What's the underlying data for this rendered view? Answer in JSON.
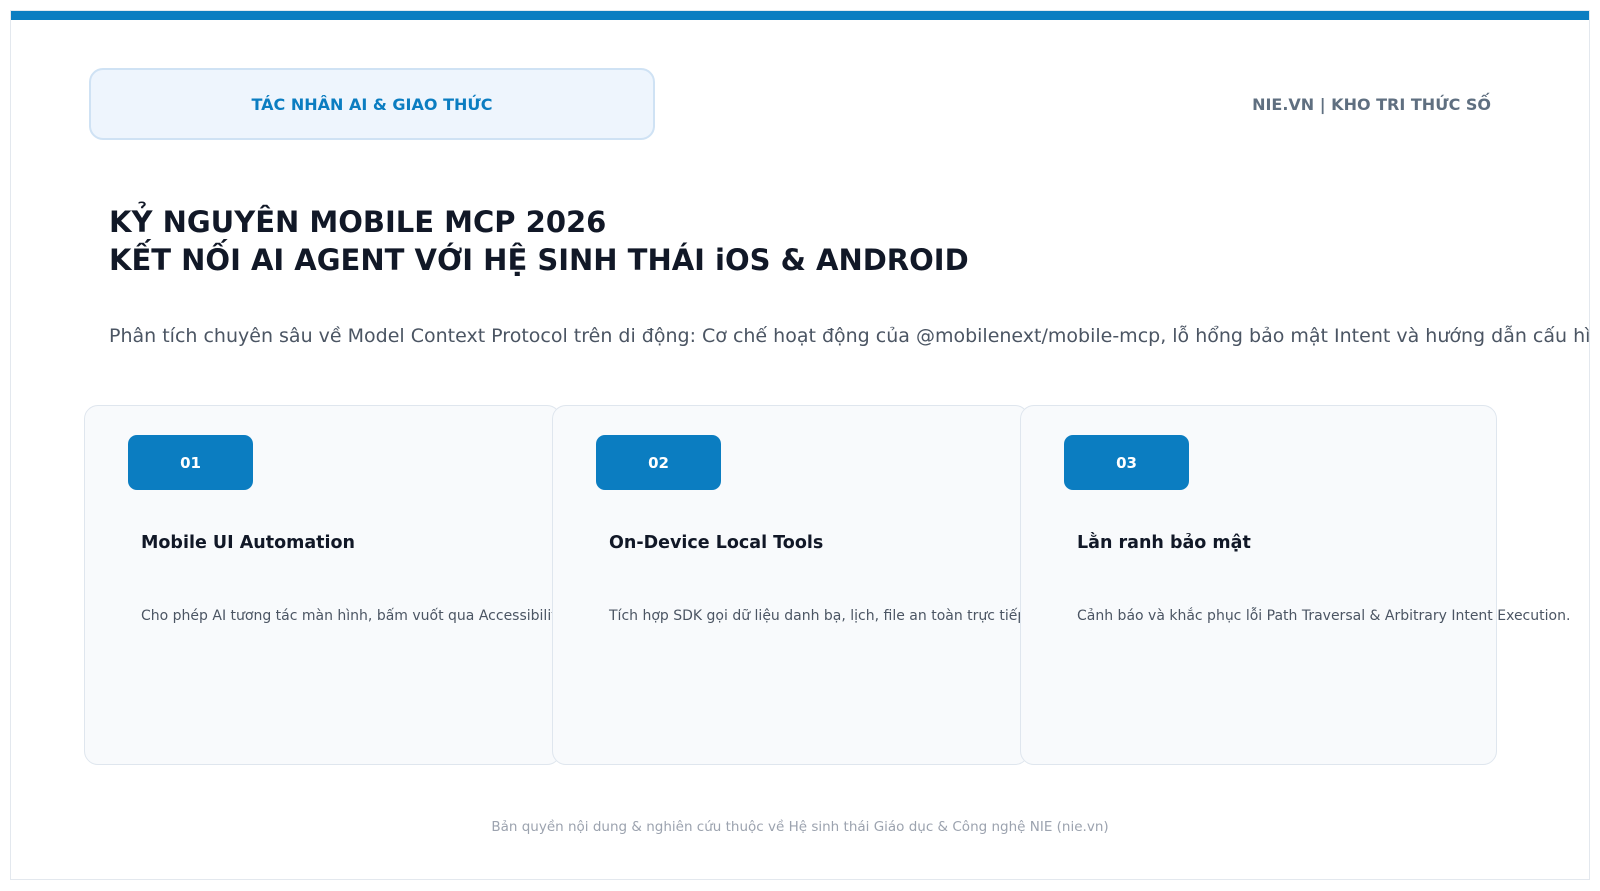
{
  "header": {
    "category": "TÁC NHÂN AI & GIAO THỨC",
    "brand": "NIE.VN | KHO TRI THỨC SỐ"
  },
  "main": {
    "title_line1": "KỶ NGUYÊN MOBILE MCP 2026",
    "title_line2": "KẾT NỐI AI AGENT VỚI HỆ SINH THÁI iOS & ANDROID",
    "subtitle": "Phân tích chuyên sâu về Model Context Protocol trên di động: Cơ chế hoạt động của @mobilenext/mobile-mcp, lỗ hổng bảo mật Intent và hướng dẫn cấu hình chi tiết."
  },
  "cards": [
    {
      "number": "01",
      "title": "Mobile UI Automation",
      "description": "Cho phép AI tương tác màn hình, bấm vuốt qua Accessibility tree hoặc tọa độ."
    },
    {
      "number": "02",
      "title": "On-Device Local Tools",
      "description": "Tích hợp SDK gọi dữ liệu danh bạ, lịch, file an toàn trực tiếp từ trong App."
    },
    {
      "number": "03",
      "title": "Lằn ranh bảo mật",
      "description": "Cảnh báo và khắc phục lỗi Path Traversal & Arbitrary Intent Execution."
    }
  ],
  "footer": {
    "copyright": "Bản quyền nội dung & nghiên cứu thuộc về Hệ sinh thái Giáo dục & Công nghệ NIE (nie.vn)"
  },
  "colors": {
    "accent": "#0b7dc1",
    "pill_background": "#eef5fd",
    "card_background": "#f8fafc",
    "title_text": "#111827"
  }
}
